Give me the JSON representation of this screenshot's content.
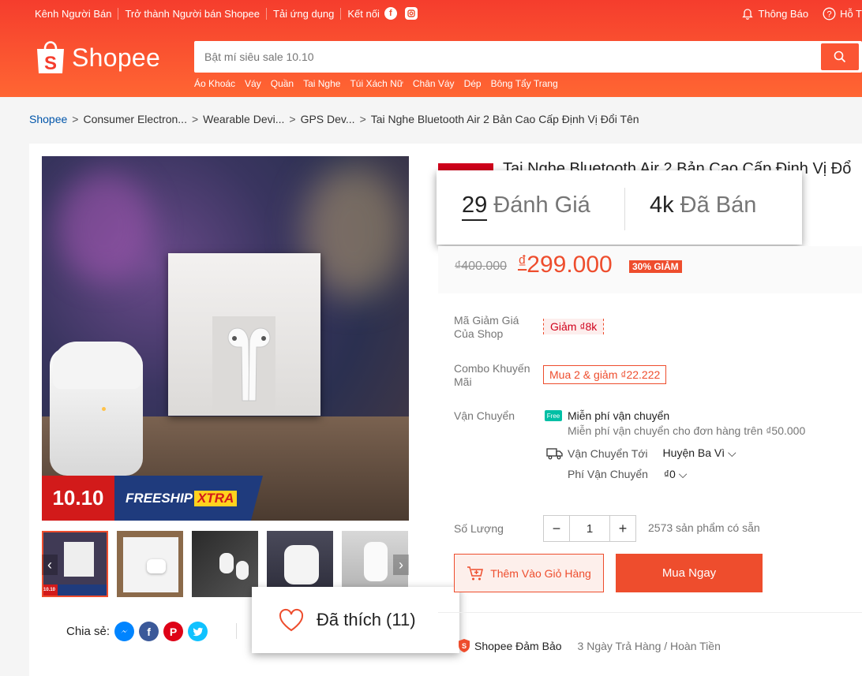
{
  "header": {
    "top_links": [
      "Kênh Người Bán",
      "Trở thành Người bán Shopee",
      "Tải ứng dụng",
      "Kết nối"
    ],
    "notifications": "Thông Báo",
    "help": "Hỗ T",
    "logo_text": "Shopee",
    "search_placeholder": "Bật mí siêu sale 10.10",
    "quick_links": [
      "Áo Khoác",
      "Váy",
      "Quần",
      "Tai Nghe",
      "Túi Xách Nữ",
      "Chân Váy",
      "Dép",
      "Bông Tẩy Trang"
    ]
  },
  "breadcrumb": [
    "Shopee",
    "Consumer Electron...",
    "Wearable Devi...",
    "GPS Dev...",
    "Tai Nghe Bluetooth Air 2 Bản Cao Cấp Định Vị Đổi Tên"
  ],
  "gallery": {
    "banner_left": "10.10",
    "banner_free": "FREESHIP",
    "banner_xtra": "XTRA",
    "thumb_banner": "10.10"
  },
  "share": {
    "label": "Chia sẻ:"
  },
  "like": {
    "text": "Đã thích (11)"
  },
  "product": {
    "title": "Tai Nghe Bluetooth Air 2 Bản Cao Cấp Định Vị Đổ",
    "rating_count": "29",
    "rating_label": "Đánh Giá",
    "sold_count": "4k",
    "sold_label": "Đã Bán",
    "old_price": "₫400.000",
    "currency": "₫",
    "price": "299.000",
    "discount": "30% GIẢM"
  },
  "details": {
    "voucher_label": "Mã Giảm Giá Của Shop",
    "voucher_value": "Giảm ₫8k",
    "combo_label": "Combo Khuyến Mãi",
    "combo_value": "Mua 2 & giảm ₫22.222",
    "shipping_label": "Vận Chuyển",
    "free_ship_icon": "Free",
    "free_ship": "Miễn phí vận chuyển",
    "free_ship_note": "Miễn phí vận chuyển cho đơn hàng trên ₫50.000",
    "ship_to_label": "Vận Chuyển Tới",
    "ship_to_value": "Huyện Ba Vì",
    "ship_fee_label": "Phí Vận Chuyển",
    "ship_fee_value": "₫0",
    "qty_label": "Số Lượng",
    "qty_minus": "−",
    "qty_value": "1",
    "qty_plus": "+",
    "stock": "2573 sản phẩm có sẵn"
  },
  "actions": {
    "add_to_cart": "Thêm Vào Giỏ Hàng",
    "buy_now": "Mua Ngay"
  },
  "guarantee": {
    "title": "Shopee Đảm Bảo",
    "desc": "3 Ngày Trả Hàng / Hoàn Tiền"
  },
  "colors": {
    "brand": "#ee4d2d",
    "header_top": "#f53d2d",
    "header_bottom": "#ff6633"
  }
}
